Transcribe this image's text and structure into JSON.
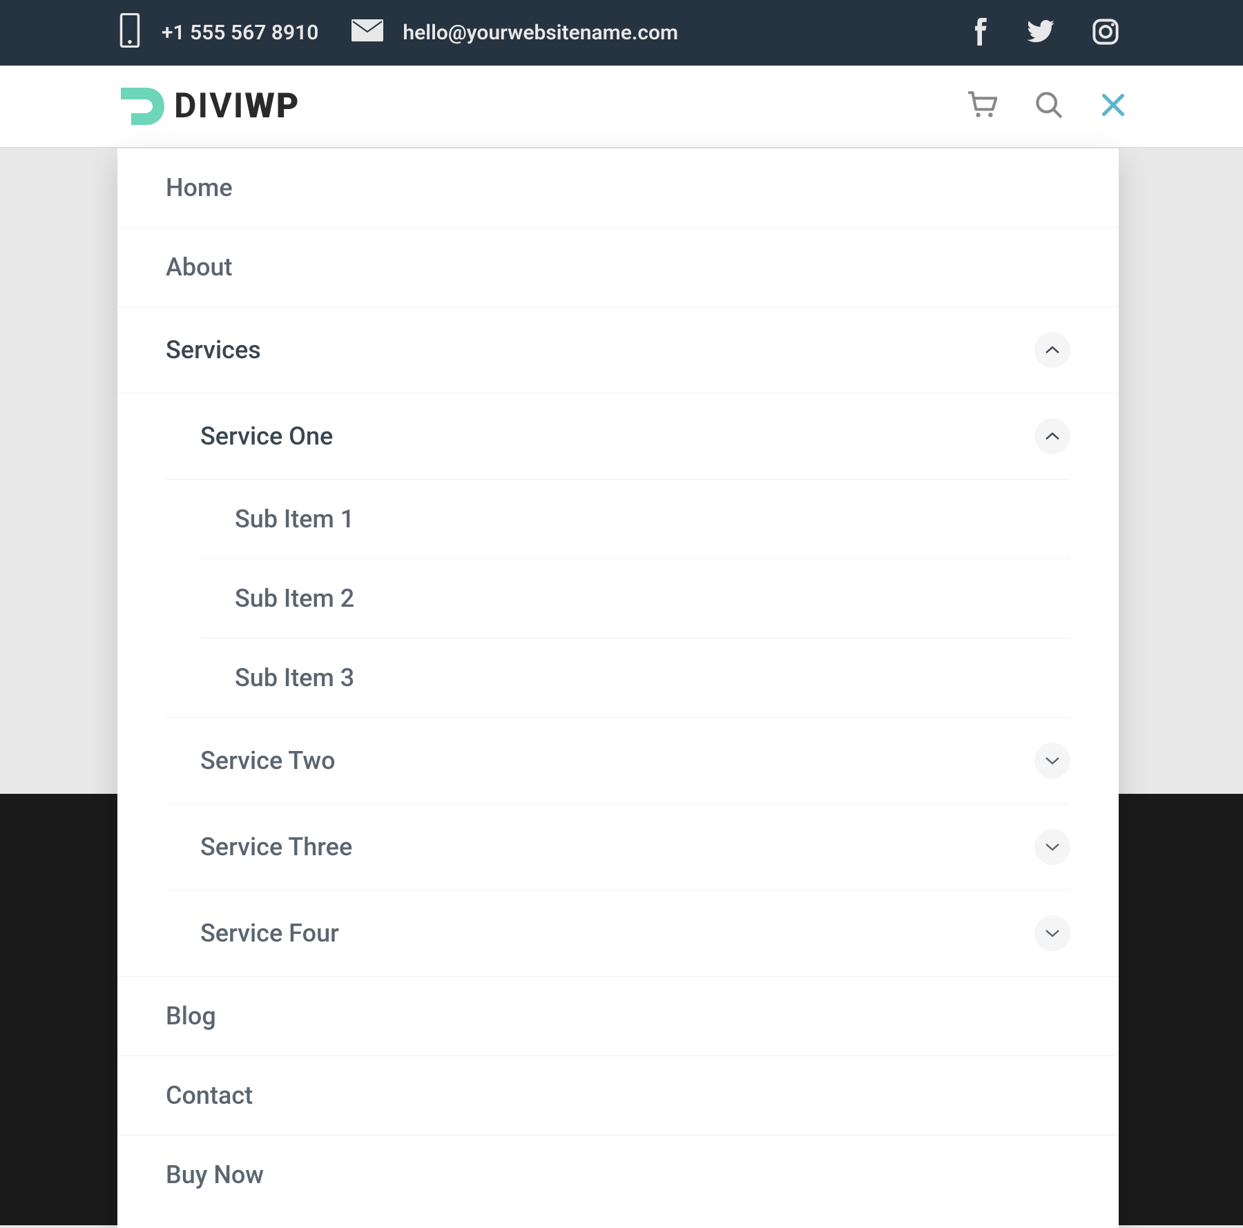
{
  "topbar": {
    "phone": "+1 555 567 8910",
    "email": "hello@yourwebsitename.com"
  },
  "logo": {
    "part1": "DIVI",
    "part2": "WP"
  },
  "menu": {
    "home": "Home",
    "about": "About",
    "services": "Services",
    "service_one": "Service One",
    "sub_item_1": "Sub Item 1",
    "sub_item_2": "Sub Item 2",
    "sub_item_3": "Sub Item 3",
    "service_two": "Service Two",
    "service_three": "Service Three",
    "service_four": "Service Four",
    "blog": "Blog",
    "contact": "Contact",
    "buy_now": "Buy Now"
  }
}
